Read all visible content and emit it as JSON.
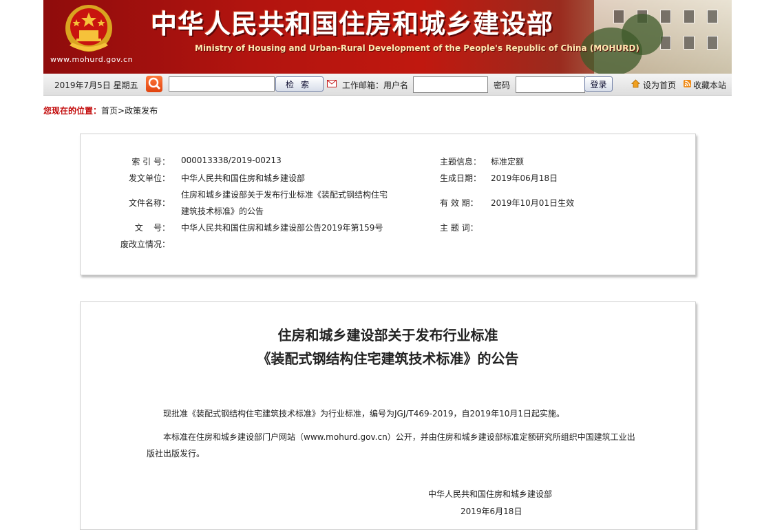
{
  "header": {
    "title_cn": "中华人民共和国住房和城乡建设部",
    "title_en": "Ministry of Housing and Urban-Rural Development of the People's Republic of China (MOHURD)",
    "site_url": "www.mohurd.gov.cn",
    "colors": {
      "banner_red": "#b2140f",
      "title_shadow": "#5a0808"
    }
  },
  "toolbar": {
    "date": "2019年7月5日  星期五",
    "search_button": "检索",
    "mail_label": "工作邮箱：用户名",
    "password_label": "密码",
    "login_button": "登录",
    "set_home": "设为首页",
    "bookmark": "收藏本站"
  },
  "breadcrumb": {
    "label": "您现在的位置：",
    "home": "首页",
    "sep": ">",
    "current": "政策发布"
  },
  "meta": {
    "index_no_label": "索 引 号：",
    "index_no": "000013338/2019-00213",
    "topic_label": "主题信息：",
    "topic": "标准定额",
    "issuer_label": "发文单位：",
    "issuer": "中华人民共和国住房和城乡建设部",
    "created_label": "生成日期：",
    "created": "2019年06月18日",
    "doc_name_label": "文件名称：",
    "doc_name_line1": "住房和城乡建设部关于发布行业标准《装配式钢结构住宅",
    "doc_name_line2": "建筑技术标准》的公告",
    "valid_label": "有 效 期：",
    "valid": "2019年10月01日生效",
    "doc_no_label": "文    号：",
    "doc_no": "中华人民共和国住房和城乡建设部公告2019年第159号",
    "keywords_label": "主 题 词：",
    "status_label": "废改立情况："
  },
  "document": {
    "title_line1": "住房和城乡建设部关于发布行业标准",
    "title_line2": "《装配式钢结构住宅建筑技术标准》的公告",
    "para1": "现批准《装配式钢结构住宅建筑技术标准》为行业标准，编号为JGJ/T469-2019，自2019年10月1日起实施。",
    "para2_line1": "本标准在住房和城乡建设部门户网站（www.mohurd.gov.cn）公开，并由住房和城乡建设部标准定额研究所组织中国建筑工业出",
    "para2_line2": "版社出版发行。",
    "signature": "中华人民共和国住房和城乡建设部",
    "sign_date": "2019年6月18日"
  }
}
